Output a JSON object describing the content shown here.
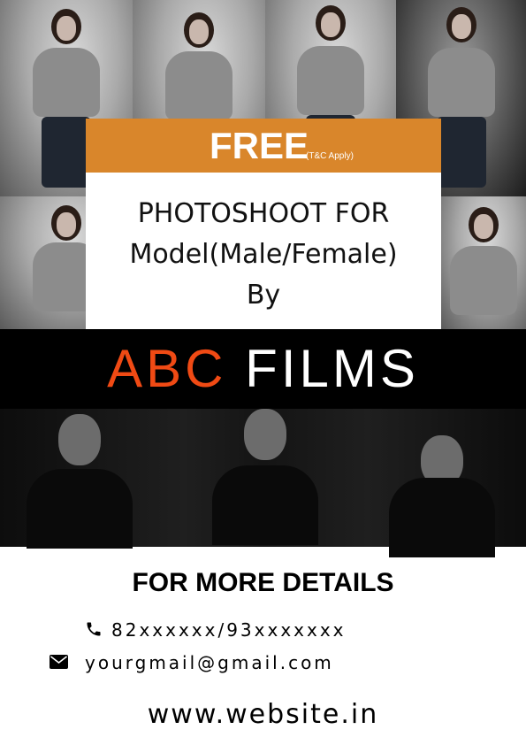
{
  "offer": {
    "headline": "FREE",
    "terms_note": "(T&C Apply)",
    "line1": "PHOTOSHOOT FOR",
    "line2": "Model(Male/Female)",
    "line3": "By"
  },
  "brand": {
    "accent": "ABC",
    "rest": "FILMS",
    "accent_color": "#f04a14"
  },
  "contact": {
    "title": "FOR MORE DETAILS",
    "phone": "82xxxxxx/93xxxxxxx",
    "phone_icon": "phone-icon",
    "email": "yourgmail@gmail.com",
    "email_icon": "envelope-icon",
    "website": "www.website.in"
  },
  "colors": {
    "offer_bar": "#d9862b",
    "band": "#000000"
  }
}
